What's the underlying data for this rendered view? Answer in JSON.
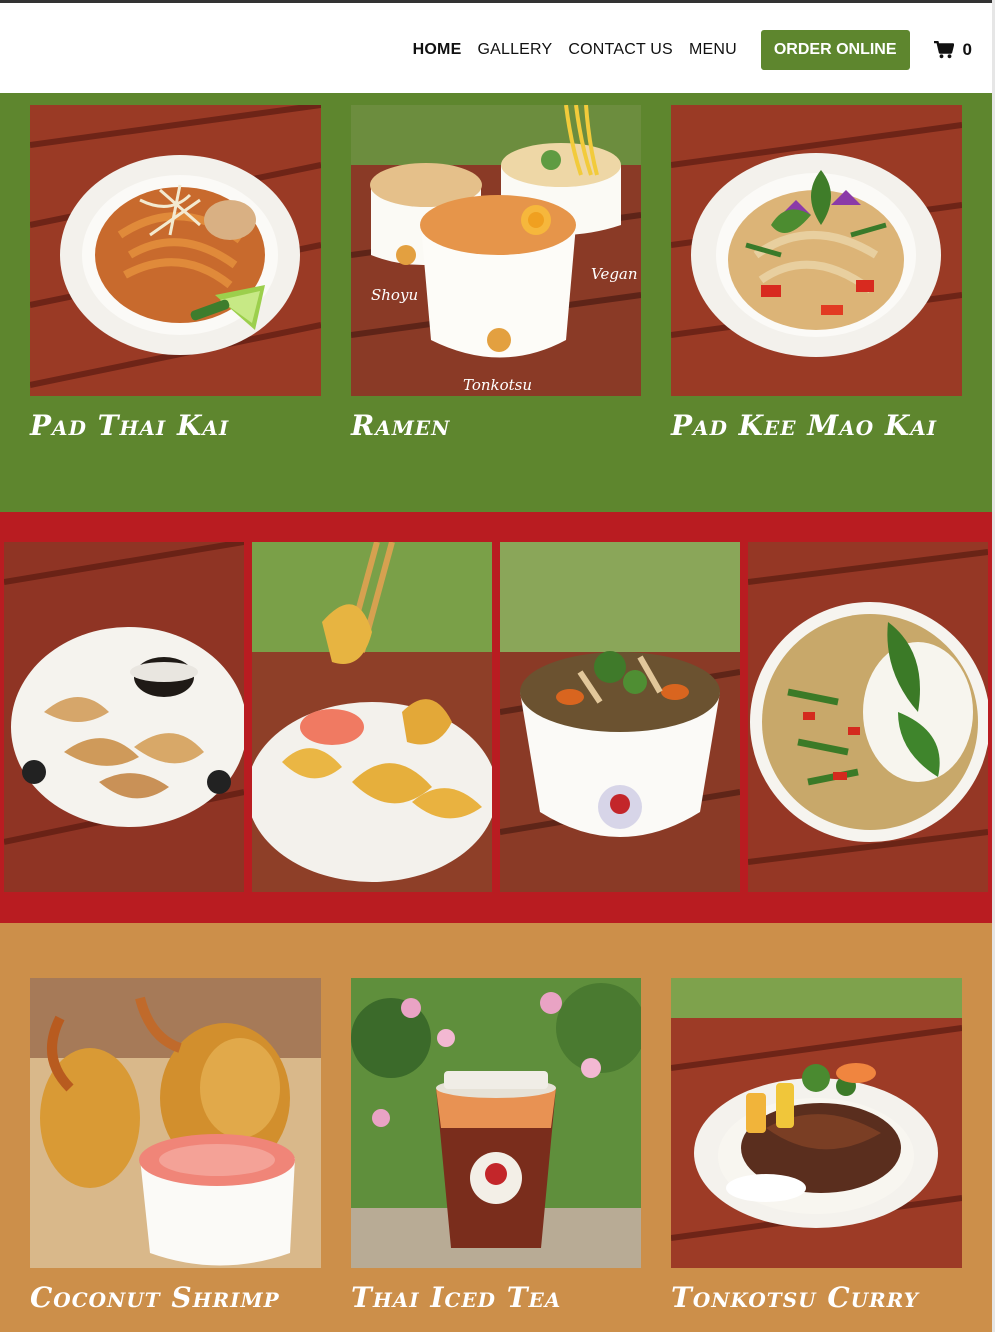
{
  "nav": {
    "items": [
      {
        "label": "HOME",
        "active": true
      },
      {
        "label": "GALLERY",
        "active": false
      },
      {
        "label": "CONTACT US",
        "active": false
      },
      {
        "label": "MENU",
        "active": false
      }
    ],
    "order_label": "ORDER ONLINE",
    "cart_icon": "shopping-cart-icon",
    "cart_count": "0"
  },
  "colors": {
    "green": "#5e862e",
    "red": "#b91c21",
    "orange": "#cc8f4a",
    "order_button": "#5e862e"
  },
  "featured_top": [
    {
      "caption": "Pad Thai Kai"
    },
    {
      "caption": "Ramen",
      "photo_labels": [
        "Shoyu",
        "Vegan",
        "Tonkotsu"
      ]
    },
    {
      "caption": "Pad Kee Mao Kai"
    }
  ],
  "gallery_strip": [
    {
      "photo": "dumplings"
    },
    {
      "photo": "crab-rangoon"
    },
    {
      "photo": "noodle-bowl"
    },
    {
      "photo": "basil-stir-fry-rice"
    }
  ],
  "featured_bottom": [
    {
      "caption": "Coconut Shrimp"
    },
    {
      "caption": "Thai Iced Tea"
    },
    {
      "caption": "Tonkotsu Curry"
    }
  ]
}
